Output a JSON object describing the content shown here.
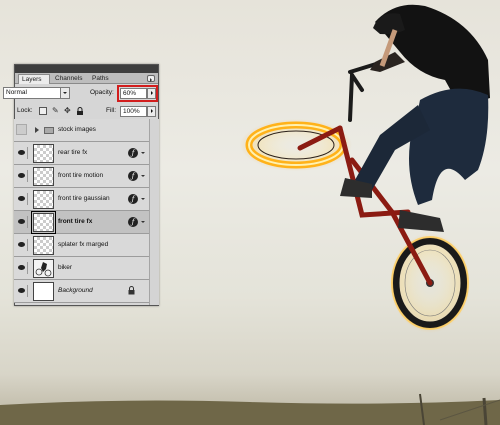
{
  "photo": {
    "description_icons": [
      "bmx-rider",
      "glowing-front-tire",
      "glowing-rear-tire",
      "sky",
      "grass",
      "fence"
    ]
  },
  "panel": {
    "tabs": [
      {
        "label": "Layers"
      },
      {
        "label": "Channels"
      },
      {
        "label": "Paths"
      }
    ],
    "blend_mode": "Normal",
    "opacity_label": "Opacity:",
    "opacity_value": "60%",
    "lock_label": "Lock:",
    "fill_label": "Fill:",
    "fill_value": "100%",
    "highlight_color": "#d21d1d",
    "layers": [
      {
        "name": "stock images",
        "type": "group",
        "visible": false
      },
      {
        "name": "rear tire fx",
        "type": "layer",
        "visible": true,
        "fx": true
      },
      {
        "name": "front tire motion",
        "type": "layer",
        "visible": true,
        "fx": true
      },
      {
        "name": "front tire gaussian",
        "type": "layer",
        "visible": true,
        "fx": true
      },
      {
        "name": "front tire fx",
        "type": "layer",
        "visible": true,
        "fx": true,
        "selected": true
      },
      {
        "name": "splater fx marged",
        "type": "layer",
        "visible": true,
        "fx": false
      },
      {
        "name": "biker",
        "type": "layer",
        "visible": true,
        "fx": false
      },
      {
        "name": "Background",
        "type": "background",
        "visible": true,
        "locked": true
      }
    ]
  },
  "colors": {
    "tire_glow": "#ffb21a",
    "bike_frame": "#8b1b12"
  }
}
